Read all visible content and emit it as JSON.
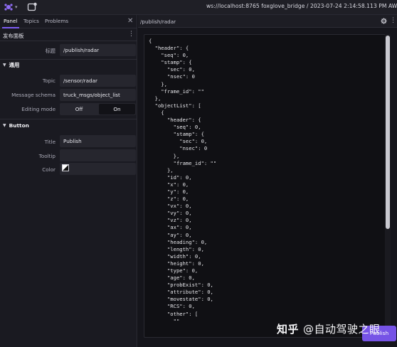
{
  "topbar": {
    "connection": "ws://localhost:8765 foxglove_bridge / 2023-07-24 2:14:58.113 PM AWST"
  },
  "left_panel": {
    "tabs": [
      {
        "label": "Panel",
        "active": true
      },
      {
        "label": "Topics",
        "active": false
      },
      {
        "label": "Problems",
        "active": false
      }
    ],
    "panel_name": "发布面板",
    "title_row": {
      "label": "标题",
      "value": "/publish/radar"
    },
    "general_section": "通用",
    "topic": {
      "label": "Topic",
      "value": "/sensor/radar"
    },
    "schema": {
      "label": "Message schema",
      "value": "truck_msgs/object_list"
    },
    "editing_mode": {
      "label": "Editing mode",
      "off_label": "Off",
      "on_label": "On",
      "selected": "On"
    },
    "button_section": "Button",
    "button_title": {
      "label": "Title",
      "value": "Publish"
    },
    "tooltip": {
      "label": "Tooltip",
      "value": ""
    },
    "color": {
      "label": "Color",
      "value": ""
    }
  },
  "right_panel": {
    "title": "/publish/radar",
    "code_lines": [
      "{",
      "  \"header\": {",
      "    \"seq\": 0,",
      "    \"stamp\": {",
      "      \"sec\": 0,",
      "      \"nsec\": 0",
      "    },",
      "    \"frame_id\": \"\"",
      "  },",
      "  \"objectList\": [",
      "    {",
      "      \"header\": {",
      "        \"seq\": 0,",
      "        \"stamp\": {",
      "          \"sec\": 0,",
      "          \"nsec\": 0",
      "        },",
      "        \"frame_id\": \"\"",
      "      },",
      "      \"id\": 0,",
      "      \"x\": 0,",
      "      \"y\": 0,",
      "      \"z\": 0,",
      "      \"vx\": 0,",
      "      \"vy\": 0,",
      "      \"vz\": 0,",
      "      \"ax\": 0,",
      "      \"ay\": 0,",
      "      \"heading\": 0,",
      "      \"length\": 0,",
      "      \"width\": 0,",
      "      \"height\": 0,",
      "      \"type\": 0,",
      "      \"age\": 0,",
      "      \"probExist\": 0,",
      "      \"attribute\": 0,",
      "      \"movestate\": 0,",
      "      \"RCS\": 0,",
      "      \"other\": [",
      "        \"\""
    ],
    "publish_label": "Publish"
  },
  "watermark": {
    "brand": "知乎",
    "author": "@自动驾驶之眼"
  },
  "colors": {
    "accent": "#7653e6",
    "background": "#121217",
    "panel": "#1a1a21"
  }
}
